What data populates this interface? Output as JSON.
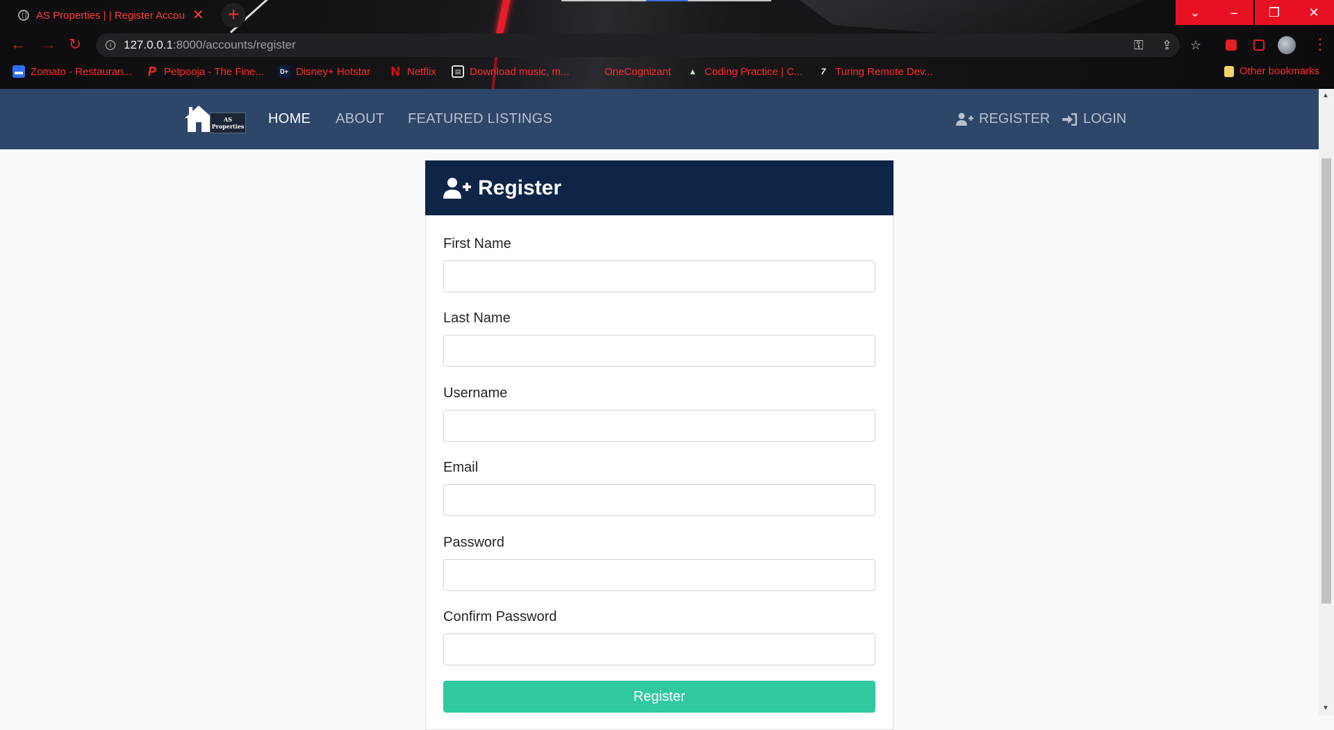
{
  "browser": {
    "tab_title": "AS Properties | | Register Account",
    "url_host": "127.0.0.1",
    "url_path": ":8000/accounts/register",
    "bookmarks": [
      {
        "label": "Zomato - Restauran...",
        "icon": "zomato-icon"
      },
      {
        "label": "Petpooja - The Fine...",
        "icon": "petpooja-icon"
      },
      {
        "label": "Disney+ Hotstar",
        "icon": "hotstar-icon"
      },
      {
        "label": "Netflix",
        "icon": "netflix-icon"
      },
      {
        "label": "Download music, m...",
        "icon": "music-icon"
      },
      {
        "label": "OneCognizant",
        "icon": "cognizant-icon"
      },
      {
        "label": "Coding Practice | C...",
        "icon": "coding-icon"
      },
      {
        "label": "Turing Remote Dev...",
        "icon": "turing-icon"
      }
    ],
    "other_bookmarks": "Other bookmarks"
  },
  "site": {
    "logo_text": "AS Properties",
    "nav": {
      "home": "HOME",
      "about": "ABOUT",
      "featured": "FEATURED LISTINGS",
      "register": "REGISTER",
      "login": "LOGIN"
    }
  },
  "form": {
    "title": "Register",
    "fields": [
      {
        "label": "First Name",
        "value": ""
      },
      {
        "label": "Last Name",
        "value": ""
      },
      {
        "label": "Username",
        "value": ""
      },
      {
        "label": "Email",
        "value": ""
      },
      {
        "label": "Password",
        "value": ""
      },
      {
        "label": "Confirm Password",
        "value": ""
      }
    ],
    "submit": "Register"
  },
  "colors": {
    "navbar": "#2e466a",
    "card_header": "#0f2547",
    "submit": "#30c9a0",
    "browser_accent": "#e81123"
  }
}
